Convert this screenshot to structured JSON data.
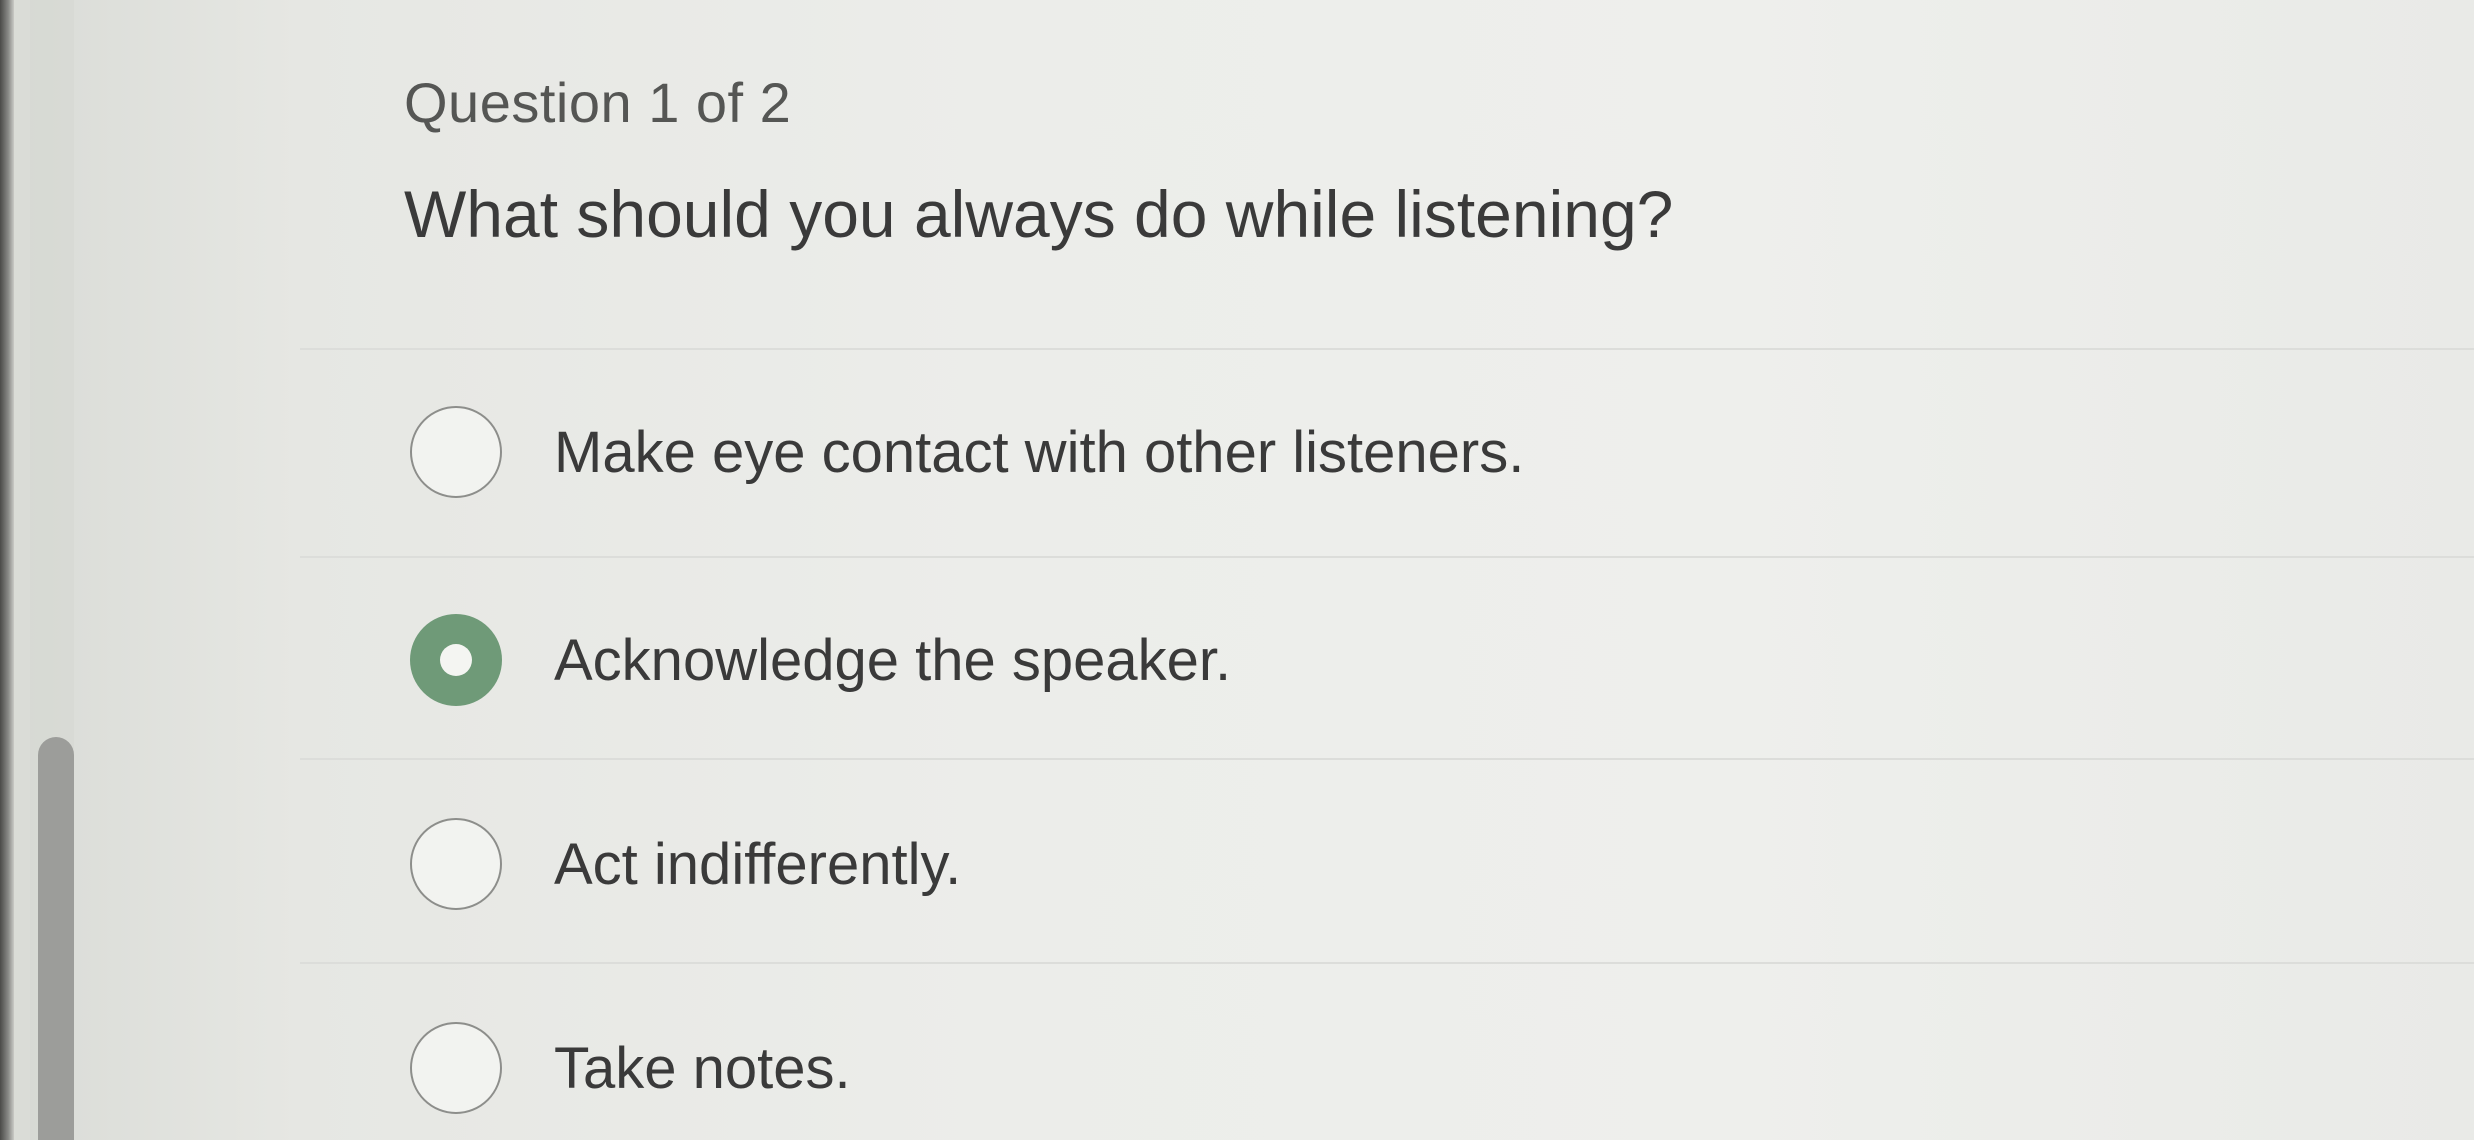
{
  "quiz": {
    "counter": "Question 1 of 2",
    "question": "What should you always do while listening?",
    "options": [
      {
        "label": "Make eye contact with other listeners.",
        "selected": false
      },
      {
        "label": "Acknowledge the speaker.",
        "selected": true
      },
      {
        "label": "Act indifferently.",
        "selected": false
      },
      {
        "label": "Take notes.",
        "selected": false
      }
    ]
  },
  "colors": {
    "selected_radio": "#6f9a78",
    "text": "#3a3a3a"
  }
}
